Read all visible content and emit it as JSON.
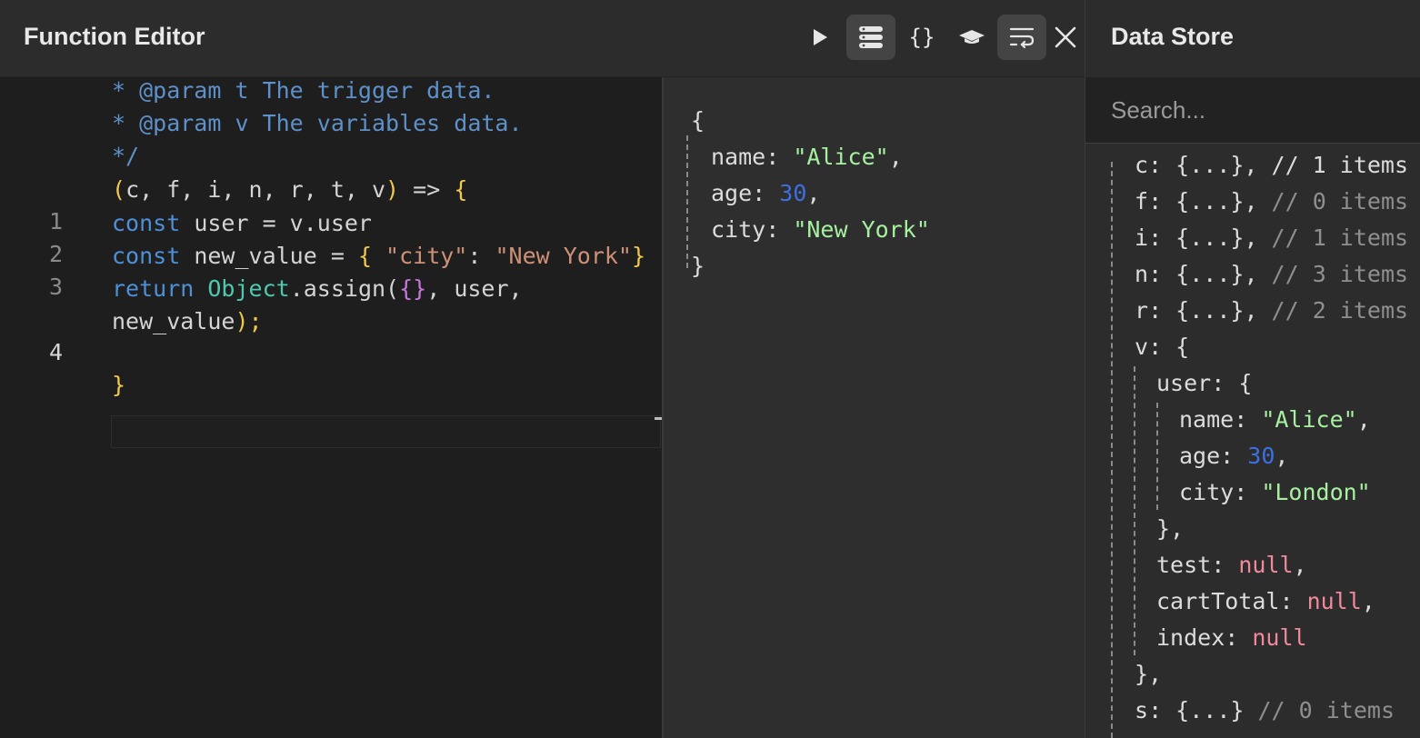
{
  "editor": {
    "title": "Function Editor",
    "toolbar": {
      "run_icon": "play-icon",
      "data_icon": "database-icon",
      "json_icon": "braces-icon",
      "learn_icon": "graduation-cap-icon",
      "wrap_icon": "word-wrap-icon",
      "close_icon": "close-icon",
      "json_label": "{}"
    },
    "header_lines": [
      "* @param t The trigger data.",
      "* @param v The variables data.",
      "*/"
    ],
    "signature": {
      "open": "(",
      "params": "c, f, i, n, r, t, v",
      "close": ")",
      "arrow": " => ",
      "brace": "{"
    },
    "line_numbers": [
      "1",
      "2",
      "3",
      "4"
    ],
    "line1": {
      "kw": "const",
      "rest": " user = v.user"
    },
    "line2": {
      "kw": "const",
      "mid": " new_value = ",
      "open": "{",
      "key": " \"city\"",
      "colon": ": ",
      "val": "\"New York\"",
      "close": "}"
    },
    "line3": {
      "kw": "return",
      "sp": " ",
      "cls": "Object",
      "method": ".assign(",
      "obj": "{}",
      "rest": ", user,"
    },
    "line3b": {
      "text": "new_value",
      "close": ");"
    },
    "closing_brace": "}"
  },
  "output": {
    "open": "{",
    "close": "}",
    "fields": [
      {
        "key": "name",
        "value": "\"Alice\"",
        "type": "string",
        "sep": ","
      },
      {
        "key": "age",
        "value": "30",
        "type": "number",
        "sep": ","
      },
      {
        "key": "city",
        "value": "\"New York\"",
        "type": "string",
        "sep": ""
      }
    ]
  },
  "datastore": {
    "title": "Data Store",
    "search_placeholder": "Search...",
    "top_partial": "c: {...}, // 1 items",
    "items": [
      {
        "key": "f",
        "summary": "{...}",
        "comment": "// 0 items"
      },
      {
        "key": "i",
        "summary": "{...}",
        "comment": "// 1 items"
      },
      {
        "key": "n",
        "summary": "{...}",
        "comment": "// 3 items"
      },
      {
        "key": "r",
        "summary": "{...}",
        "comment": "// 2 items"
      }
    ],
    "v_key": "v",
    "user_key": "user",
    "user_fields": [
      {
        "key": "name",
        "value": "\"Alice\"",
        "type": "string",
        "sep": ","
      },
      {
        "key": "age",
        "value": "30",
        "type": "number",
        "sep": ","
      },
      {
        "key": "city",
        "value": "\"London\"",
        "type": "string",
        "sep": ""
      }
    ],
    "v_fields": [
      {
        "key": "test",
        "value": "null",
        "sep": ","
      },
      {
        "key": "cartTotal",
        "value": "null",
        "sep": ","
      },
      {
        "key": "index",
        "value": "null",
        "sep": ""
      }
    ],
    "user_close": "},",
    "v_close": "},",
    "s_item": {
      "key": "s",
      "summary": "{...}",
      "comment": "// 0 items"
    }
  },
  "colors": {
    "string": "#a6f0a0",
    "number": "#3c6fe0",
    "null": "#f08a9a",
    "comment": "#5e90c9",
    "keyword": "#4e8fd6"
  }
}
